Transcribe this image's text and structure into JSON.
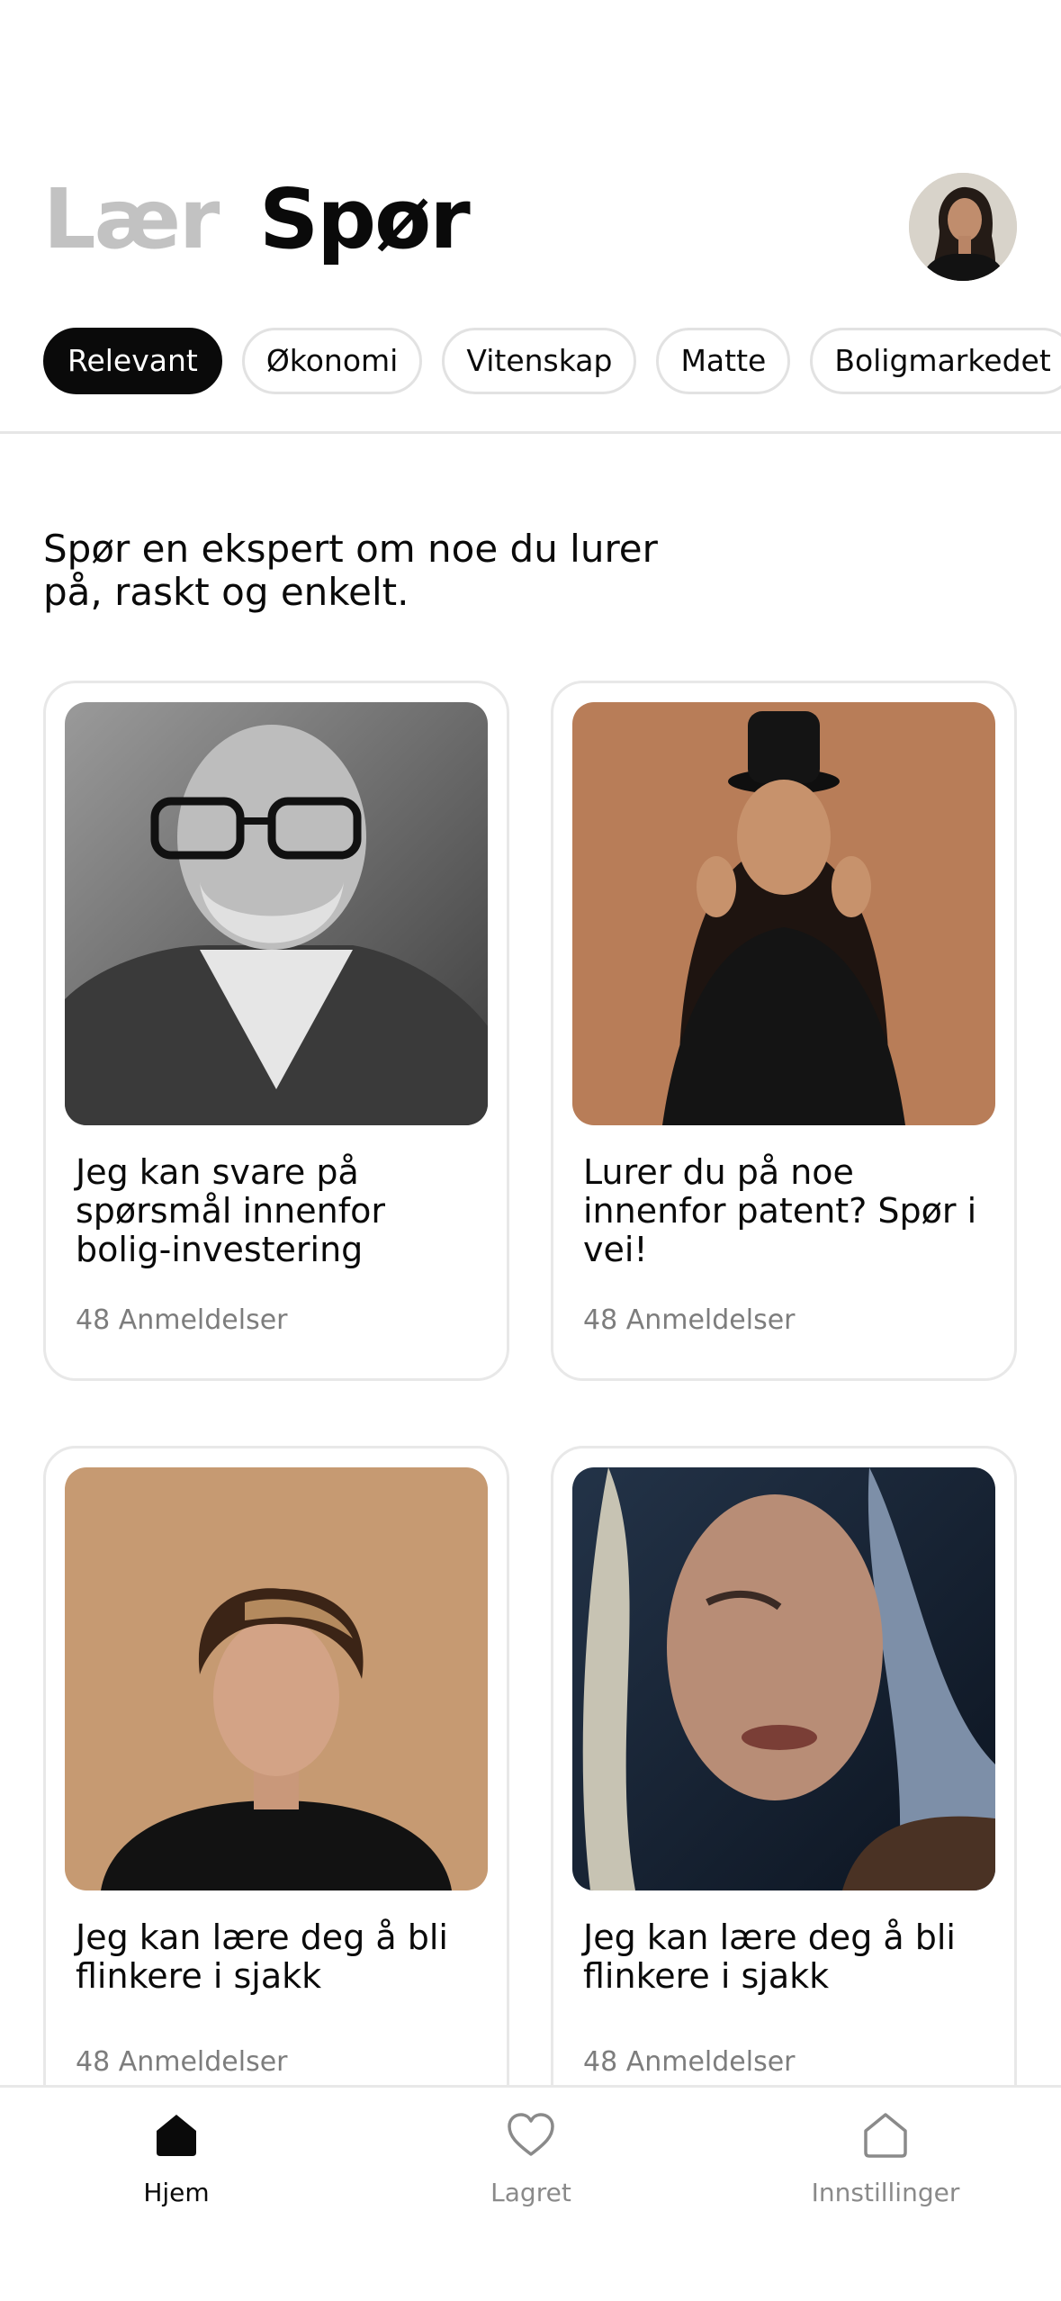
{
  "header": {
    "tabs": [
      {
        "label": "Lær",
        "active": false
      },
      {
        "label": "Spør",
        "active": true
      }
    ],
    "avatar_icon": "user-avatar"
  },
  "categories": [
    {
      "label": "Relevant",
      "active": true
    },
    {
      "label": "Økonomi",
      "active": false
    },
    {
      "label": "Vitenskap",
      "active": false
    },
    {
      "label": "Matte",
      "active": false
    },
    {
      "label": "Boligmarkedet",
      "active": false
    }
  ],
  "intro": "Spør en ekspert om noe du lurer på, raskt og enkelt.",
  "experts": [
    {
      "title": "Jeg kan svare på spørsmål innenfor bolig-investering",
      "reviews": "48 Anmeldelser"
    },
    {
      "title": "Lurer du på noe innenfor patent? Spør i vei!",
      "reviews": "48 Anmeldelser"
    },
    {
      "title": "Jeg kan lære deg å bli flinkere i sjakk",
      "reviews": "48 Anmeldelser"
    },
    {
      "title": "Jeg kan lære deg å bli flinkere i sjakk",
      "reviews": "48 Anmeldelser"
    }
  ],
  "nav": [
    {
      "label": "Hjem",
      "icon": "home-icon",
      "active": true
    },
    {
      "label": "Lagret",
      "icon": "heart-icon",
      "active": false
    },
    {
      "label": "Innstillinger",
      "icon": "settings-house-icon",
      "active": false
    }
  ],
  "colors": {
    "accent": "#0a0a0a",
    "muted": "#c2c2c2",
    "border": "#e8e8e8"
  }
}
